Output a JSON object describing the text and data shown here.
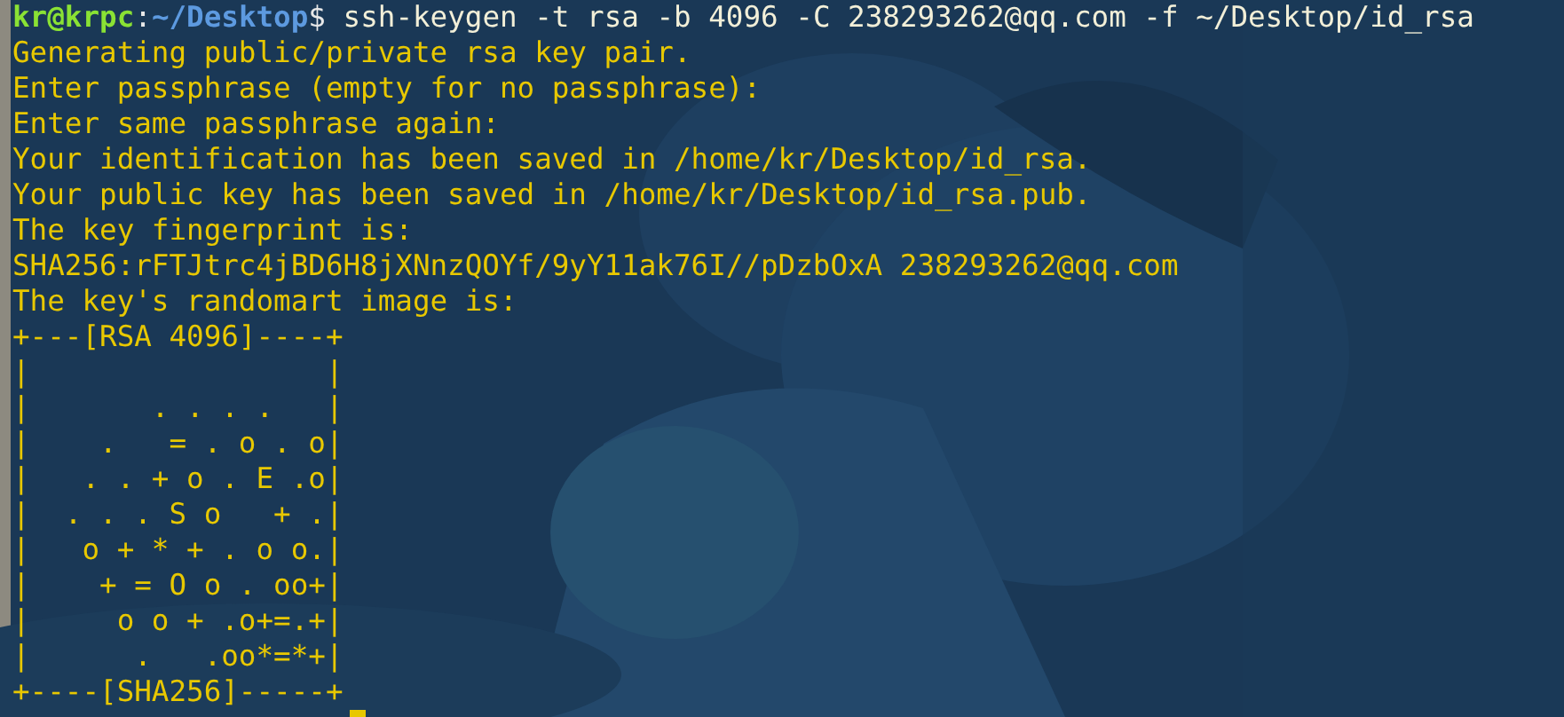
{
  "prompt": {
    "user_host": "kr@krpc",
    "separator": ":",
    "path": "~/Desktop",
    "symbol": "$",
    "command": " ssh-keygen -t rsa -b 4096 -C 238293262@qq.com -f ~/Desktop/id_rsa"
  },
  "output": [
    "Generating public/private rsa key pair.",
    "Enter passphrase (empty for no passphrase):",
    "Enter same passphrase again:",
    "Your identification has been saved in /home/kr/Desktop/id_rsa.",
    "Your public key has been saved in /home/kr/Desktop/id_rsa.pub.",
    "The key fingerprint is:",
    "SHA256:rFTJtrc4jBD6H8jXNnzQOYf/9yY11ak76I//pDzbOxA 238293262@qq.com",
    "The key's randomart image is:",
    "+---[RSA 4096]----+",
    "|                 |",
    "|       . . . .   |",
    "|    .   = . o . o|",
    "|   . . + o . E .o|",
    "|  . . . S o   + .|",
    "|   o + * + . o o.|",
    "|    + = O o . oo+|",
    "|     o o + .o+=.+|",
    "|      .   .oo*=*+|",
    "+----[SHA256]-----+"
  ]
}
